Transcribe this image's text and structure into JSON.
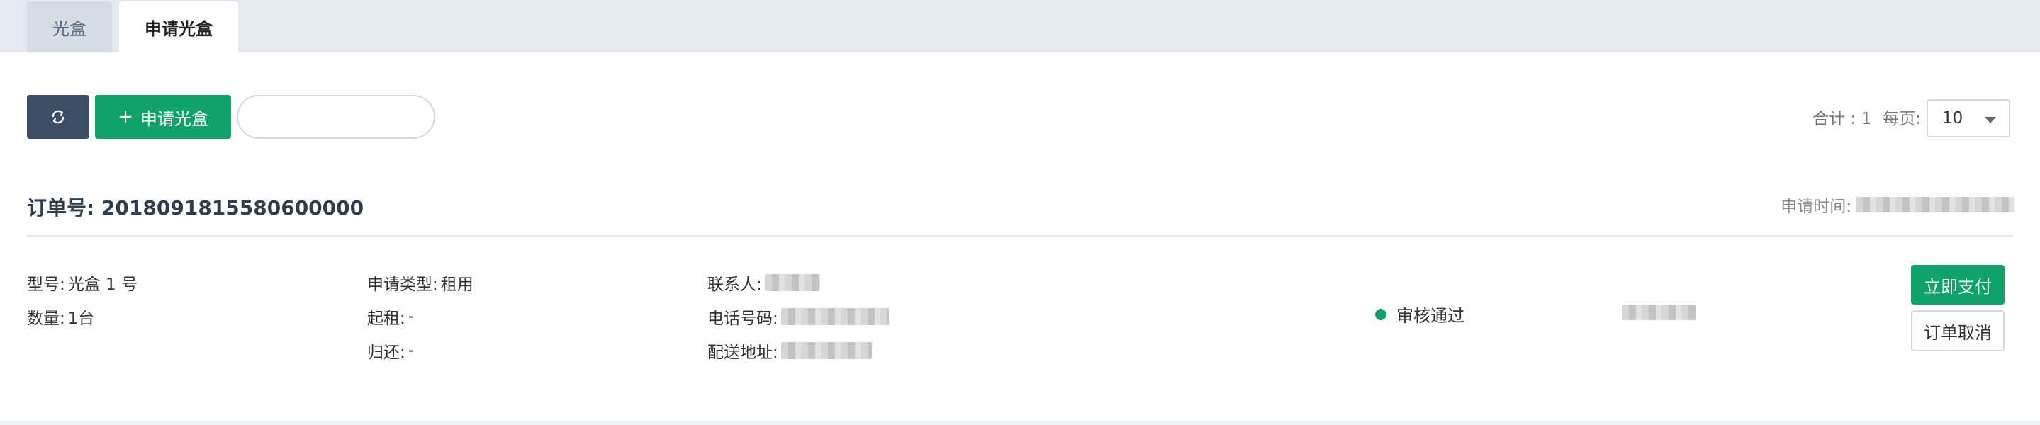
{
  "tabs": [
    {
      "label": "光盒"
    },
    {
      "label": "申请光盒"
    }
  ],
  "toolbar": {
    "apply_label": "申请光盒",
    "search_value": ""
  },
  "pager": {
    "total_text": "合计 : 1",
    "per_page_label": "每页:",
    "per_page_value": "10"
  },
  "order": {
    "number_text": "订单号: 2018091815580600000",
    "apply_time_label": "申请时间:",
    "model": {
      "label": "型号:",
      "value": "光盒 1 号"
    },
    "quantity": {
      "label": "数量:",
      "value": "1台"
    },
    "apply_type": {
      "label": "申请类型:",
      "value": "租用"
    },
    "rent_start": {
      "label": "起租:",
      "value": "-"
    },
    "rent_return": {
      "label": "归还:",
      "value": "-"
    },
    "contact": {
      "label": "联系人:"
    },
    "phone": {
      "label": "电话号码:"
    },
    "address": {
      "label": "配送地址:"
    },
    "status": "审核通过",
    "pay_label": "立即支付",
    "cancel_label": "订单取消"
  },
  "colors": {
    "accent": "#0fa36b",
    "dark_button": "#3c4e65",
    "tab_bar": "#e4e8ef"
  },
  "icons": [
    "refresh-icon",
    "plus-icon",
    "chevron-down-icon",
    "status-dot-icon"
  ]
}
